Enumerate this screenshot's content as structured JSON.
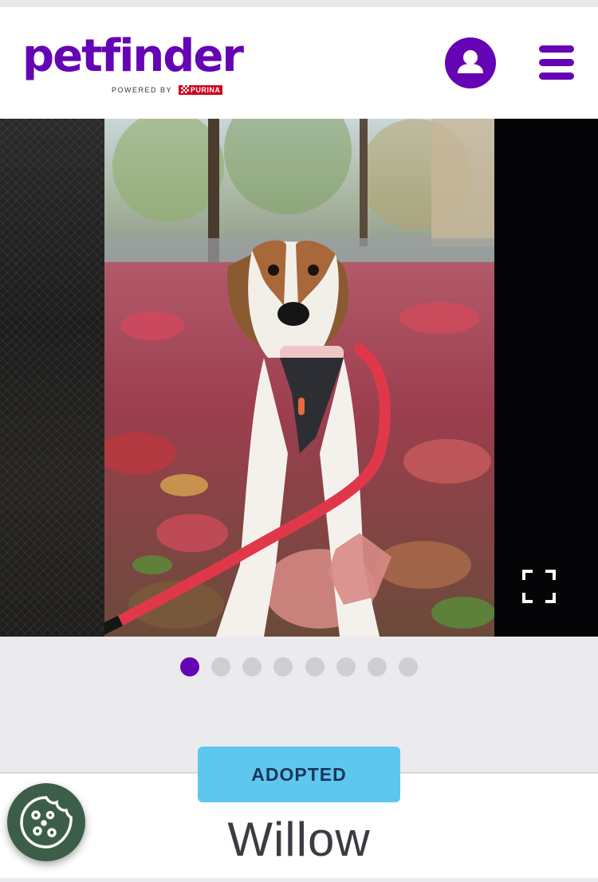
{
  "header": {
    "logo_text": "petfinder",
    "logo_powered_by": "POWERED BY",
    "logo_partner": "PURINA",
    "account_icon": "user-account-icon",
    "menu_icon": "hamburger-menu-icon",
    "brand_color": "#6504b5"
  },
  "gallery": {
    "photo_subject": "dog-photo",
    "expand_icon": "fullscreen-expand-icon",
    "total_photos": 8,
    "current_photo": 1
  },
  "pet": {
    "status": "ADOPTED",
    "status_color": "#5ec7f0",
    "name": "Willow"
  },
  "cookie": {
    "icon": "cookie-icon",
    "color": "#3c5e49"
  }
}
